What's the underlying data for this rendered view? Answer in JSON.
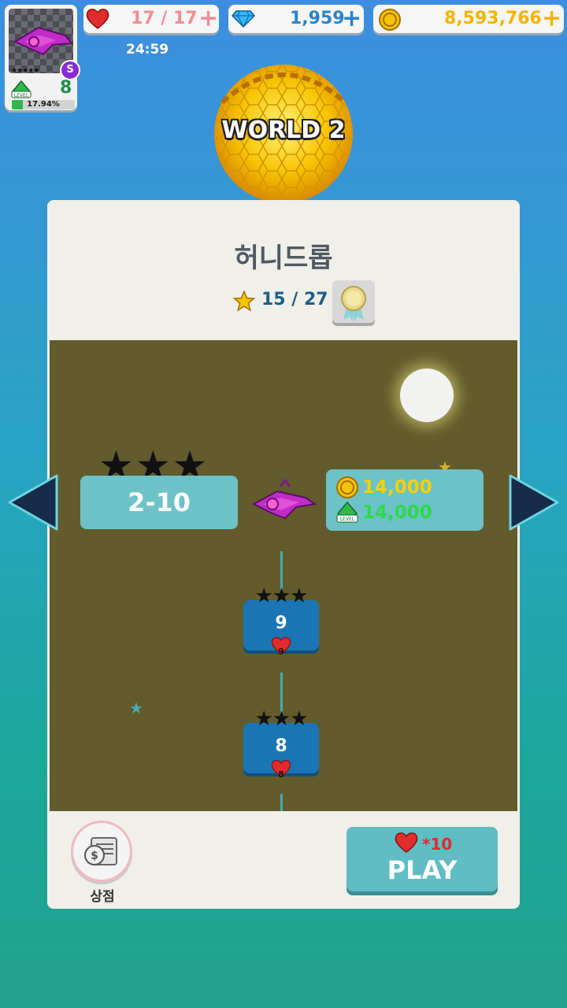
{
  "hud": {
    "hearts": "17 / 17",
    "gems": "1,959",
    "coins": "8,593,766",
    "timer": "24:59",
    "rank": "S",
    "avatar_stars": "★★★★★",
    "level": "8",
    "level_label": "LEVEL",
    "xp_percent": "17.94%",
    "xp_fraction": 0.1794
  },
  "world": {
    "title": "WORLD 2",
    "stage_name": "허니드롭",
    "star_score": "15 / 27"
  },
  "map": {
    "current_stage": "2-10",
    "current_stars": "★★★",
    "reward_coins": "14,000",
    "reward_xp": "14,000",
    "nodes": [
      {
        "label": "9",
        "stars": "★★★",
        "cost": "9"
      },
      {
        "label": "8",
        "stars": "★★★",
        "cost": "8"
      }
    ]
  },
  "footer": {
    "shop_label": "상점",
    "play_cost": "*10",
    "play_label": "PLAY"
  },
  "colors": {
    "map_bg": "#625b2b",
    "node_blue": "#1b75b4",
    "card_teal": "#6cc2c6",
    "coin_yellow": "#f5c400",
    "gem_blue": "#2a84cc",
    "heart_red": "#e02c2c"
  }
}
